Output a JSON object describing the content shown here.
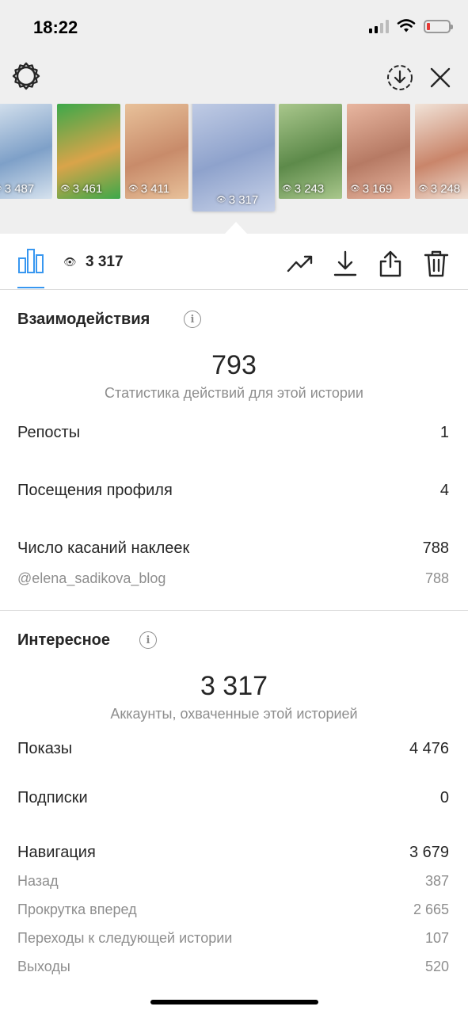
{
  "status": {
    "time": "18:22"
  },
  "thumbnails": [
    {
      "views": "3 487",
      "color": "#7ea0c8",
      "accent": "#d6e2ee"
    },
    {
      "views": "3 461",
      "color": "#d9a44a",
      "accent": "#3da84a"
    },
    {
      "views": "3 411",
      "color": "#c88b6a",
      "accent": "#e8c19a"
    },
    {
      "views": "3 317",
      "color": "#8ea2cc",
      "accent": "#c9d3e9",
      "active": true
    },
    {
      "views": "3 243",
      "color": "#5d8a4a",
      "accent": "#a9c78c"
    },
    {
      "views": "3 169",
      "color": "#b67a64",
      "accent": "#e8b6a0"
    },
    {
      "views": "3 248",
      "color": "#c9856a",
      "accent": "#f1e3d8"
    }
  ],
  "toolbar": {
    "views": "3 317"
  },
  "interactions": {
    "title": "Взаимодействия",
    "total": "793",
    "total_caption": "Статистика действий для этой истории",
    "rows": [
      {
        "label": "Репосты",
        "value": "1"
      },
      {
        "label": "Посещения профиля",
        "value": "4"
      },
      {
        "label": "Число касаний наклеек",
        "value": "788"
      }
    ],
    "sticker": {
      "label": "@elena_sadikova_blog",
      "value": "788"
    }
  },
  "discovery": {
    "title": "Интересное",
    "total": "3 317",
    "total_caption": "Аккаунты, охваченные этой историей",
    "rows": [
      {
        "label": "Показы",
        "value": "4 476"
      },
      {
        "label": "Подписки",
        "value": "0"
      },
      {
        "label": "Навигация",
        "value": "3 679"
      }
    ],
    "nav_rows": [
      {
        "label": "Назад",
        "value": "387"
      },
      {
        "label": "Прокрутка вперед",
        "value": "2 665"
      },
      {
        "label": "Переходы к следующей истории",
        "value": "107"
      },
      {
        "label": "Выходы",
        "value": "520"
      }
    ]
  },
  "colors": {
    "accent": "#3897f0",
    "text": "#262626",
    "muted": "#8e8e8e",
    "header_bg": "#efefef"
  }
}
